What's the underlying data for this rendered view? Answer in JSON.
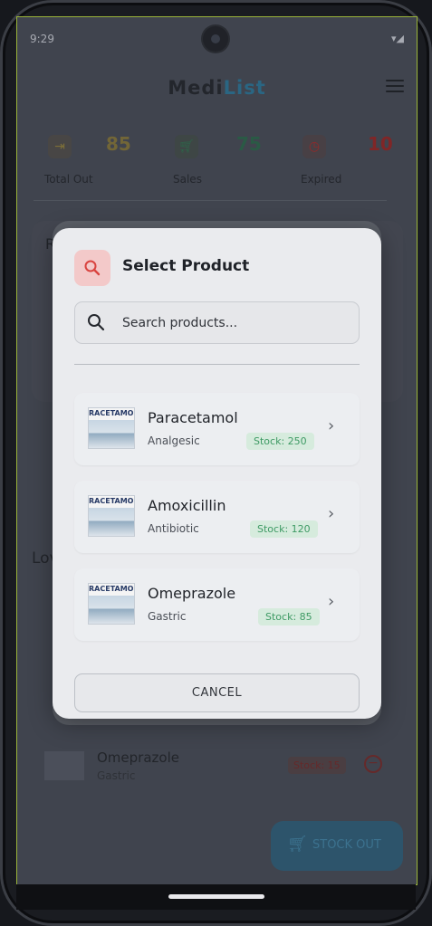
{
  "status_bar": {
    "time": "9:29",
    "icons": "▾◢"
  },
  "app": {
    "logo_a": "Medi",
    "logo_b": "List"
  },
  "stats": [
    {
      "label": "Total Out",
      "value": "85",
      "icon": "exit-icon",
      "color": "#8a7a3a"
    },
    {
      "label": "Sales",
      "value": "75",
      "icon": "cart-icon",
      "color": "#2e6e4d"
    },
    {
      "label": "Expired",
      "value": "10",
      "icon": "clock-icon",
      "color": "#a02a2a"
    }
  ],
  "background": {
    "section_letter": "R",
    "low_title": "Lov",
    "rows": [
      {
        "name": "Omeprazole",
        "category": "Gastric",
        "stock": "Stock: 15"
      }
    ],
    "fab_label": "STOCK OUT"
  },
  "dialog": {
    "title": "Select Product",
    "search_placeholder": "Search products...",
    "products": [
      {
        "name": "Paracetamol",
        "category": "Analgesic",
        "stock": "Stock: 250",
        "thumb_text": "RACETAMOL"
      },
      {
        "name": "Amoxicillin",
        "category": "Antibiotic",
        "stock": "Stock: 120",
        "thumb_text": "RACETAMOL"
      },
      {
        "name": "Omeprazole",
        "category": "Gastric",
        "stock": "Stock: 85",
        "thumb_text": "RACETAMOL"
      }
    ],
    "cancel_label": "CANCEL"
  },
  "colors": {
    "accent": "#2b6f8f",
    "danger": "#e05050",
    "success": "#3e9a64"
  }
}
